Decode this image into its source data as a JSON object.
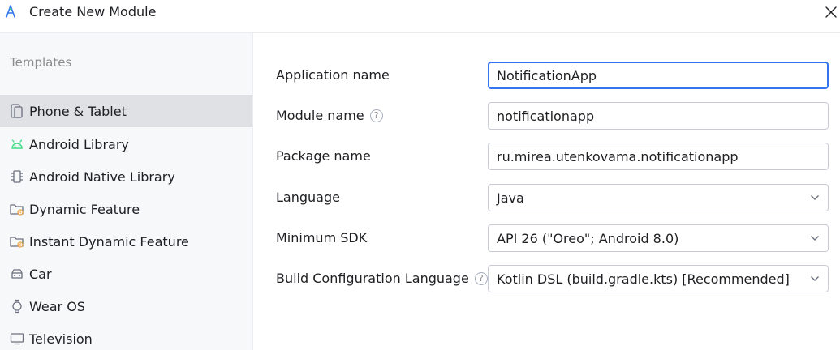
{
  "window": {
    "title": "Create New Module"
  },
  "sidebar": {
    "header": "Templates",
    "items": [
      {
        "label": "Phone & Tablet",
        "icon": "phone-tablet-icon",
        "selected": true
      },
      {
        "label": "Android Library",
        "icon": "android-icon"
      },
      {
        "label": "Android Native Library",
        "icon": "native-library-icon"
      },
      {
        "label": "Dynamic Feature",
        "icon": "dynamic-feature-folder-icon"
      },
      {
        "label": "Instant Dynamic Feature",
        "icon": "instant-dynamic-feature-folder-icon"
      },
      {
        "label": "Car",
        "icon": "car-icon"
      },
      {
        "label": "Wear OS",
        "icon": "watch-icon"
      },
      {
        "label": "Television",
        "icon": "tv-icon"
      }
    ]
  },
  "form": {
    "application_name": {
      "label": "Application name",
      "value": "NotificationApp"
    },
    "module_name": {
      "label": "Module name",
      "value": "notificationapp"
    },
    "package_name": {
      "label": "Package name",
      "value": "ru.mirea.utenkovama.notificationapp"
    },
    "language": {
      "label": "Language",
      "value": "Java"
    },
    "minimum_sdk": {
      "label": "Minimum SDK",
      "value": "API 26 (\"Oreo\"; Android 8.0)"
    },
    "build_config_language": {
      "label": "Build Configuration Language",
      "value": "Kotlin DSL (build.gradle.kts) [Recommended]"
    },
    "help_glyph": "?"
  },
  "colors": {
    "accent": "#3574f0",
    "android_green": "#3ddc84",
    "selection_bg": "#dfe1e5",
    "sidebar_bg": "#f7f8fa"
  }
}
